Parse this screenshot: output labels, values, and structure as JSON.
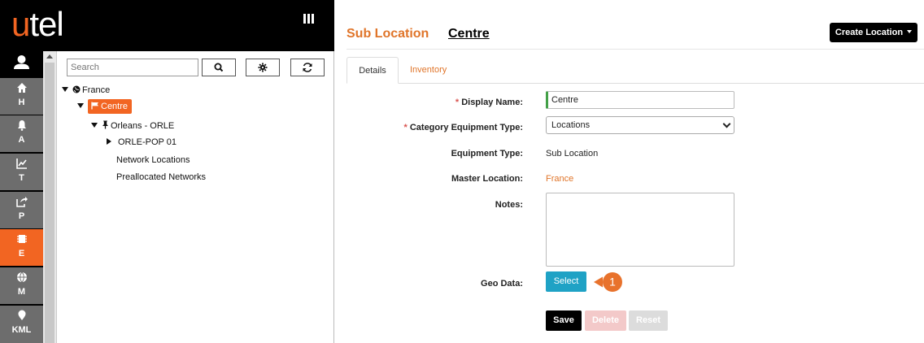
{
  "brand": {
    "logo_u": "u",
    "logo_rest": "tel",
    "accent": "#f26522"
  },
  "topbar": {
    "menu_icon": "bars-icon"
  },
  "rail": {
    "user_icon": "user-icon",
    "items": [
      {
        "icon": "home-icon",
        "label": "H"
      },
      {
        "icon": "bell-icon",
        "label": "A"
      },
      {
        "icon": "chart-icon",
        "label": "T"
      },
      {
        "icon": "share-icon",
        "label": "P"
      },
      {
        "icon": "chip-icon",
        "label": "E",
        "active": true
      },
      {
        "icon": "globe-icon",
        "label": "M"
      },
      {
        "icon": "map-pin-icon",
        "label": "KML"
      }
    ]
  },
  "tree": {
    "search_placeholder": "Search",
    "nodes": {
      "france": "France",
      "centre": "Centre",
      "orleans": "Orleans - ORLE",
      "orle_pop": "ORLE-POP 01",
      "network_locations": "Network Locations",
      "preallocated_networks": "Preallocated Networks"
    }
  },
  "header": {
    "title": "Sub Location",
    "subtitle": "Centre",
    "create_button": "Create Location"
  },
  "tabs": [
    {
      "label": "Details",
      "active": true
    },
    {
      "label": "Inventory",
      "active": false
    }
  ],
  "form": {
    "display_name_label": "Display Name:",
    "display_name_value": "Centre",
    "category_label": "Category Equipment Type:",
    "category_value": "Locations",
    "equipment_type_label": "Equipment Type:",
    "equipment_type_value": "Sub Location",
    "master_location_label": "Master Location:",
    "master_location_value": "France",
    "notes_label": "Notes:",
    "geo_label": "Geo Data:",
    "geo_button": "Select",
    "callout_number": "1",
    "required_mark": "*",
    "save": "Save",
    "delete": "Delete",
    "reset": "Reset"
  }
}
